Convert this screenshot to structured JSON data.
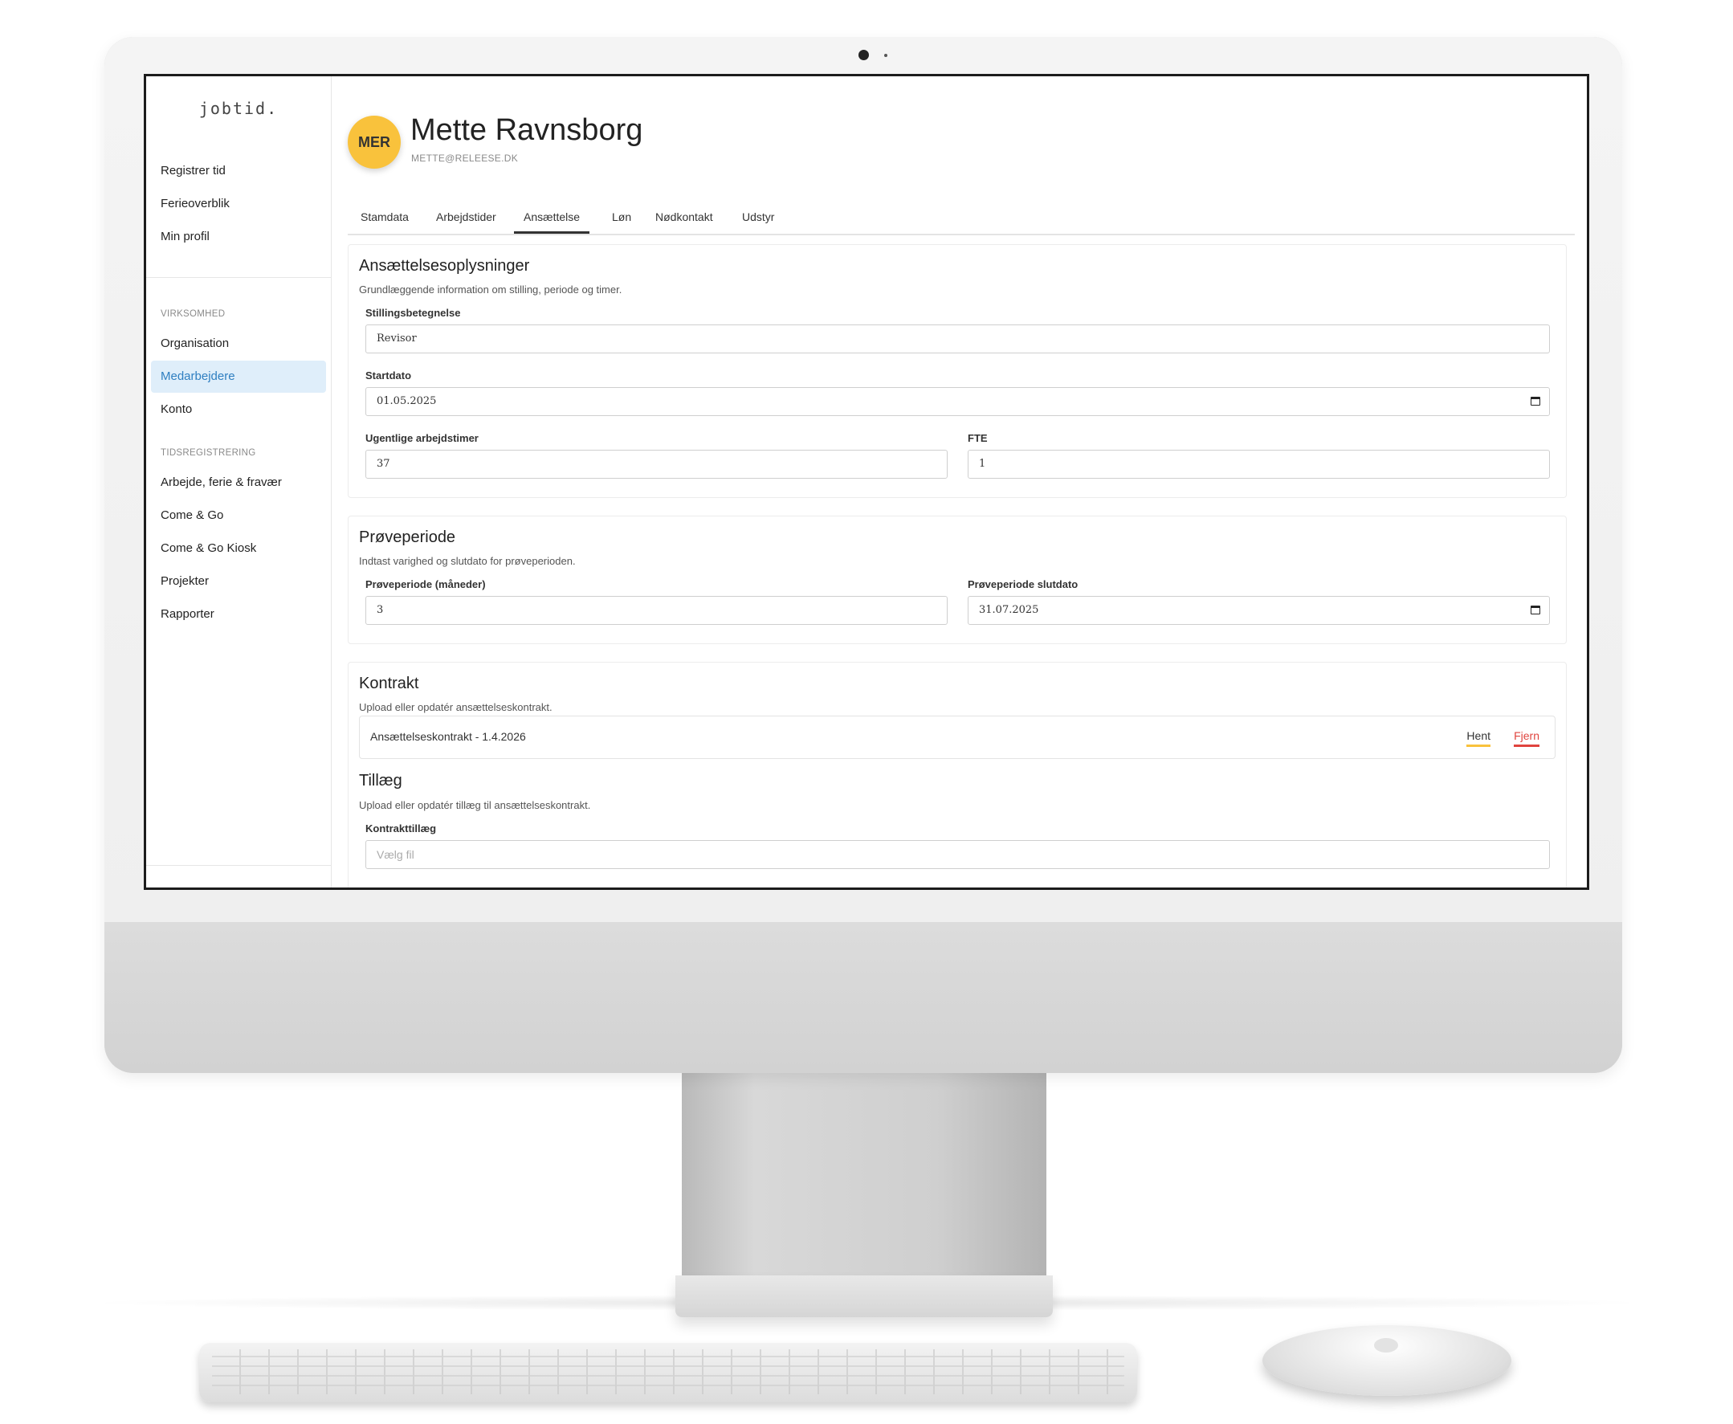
{
  "sidebar": {
    "logo": "jobtid.",
    "top_items": [
      {
        "label": "Registrer tid"
      },
      {
        "label": "Ferieoverblik"
      },
      {
        "label": "Min profil"
      }
    ],
    "sections": [
      {
        "title": "VIRKSOMHED",
        "items": [
          {
            "label": "Organisation",
            "active": false
          },
          {
            "label": "Medarbejdere",
            "active": true
          },
          {
            "label": "Konto",
            "active": false
          }
        ]
      },
      {
        "title": "TIDSREGISTRERING",
        "items": [
          {
            "label": "Arbejde, ferie & fravær"
          },
          {
            "label": "Come & Go"
          },
          {
            "label": "Come & Go Kiosk"
          },
          {
            "label": "Projekter"
          },
          {
            "label": "Rapporter"
          }
        ]
      }
    ]
  },
  "profile": {
    "initials": "MER",
    "name": "Mette Ravnsborg",
    "email": "METTE@RELEESE.DK"
  },
  "tabs": [
    {
      "label": "Stamdata",
      "active": false
    },
    {
      "label": "Arbejdstider",
      "active": false
    },
    {
      "label": "Ansættelse",
      "active": true
    },
    {
      "label": "Løn",
      "active": false
    },
    {
      "label": "Nødkontakt",
      "active": false
    },
    {
      "label": "Udstyr",
      "active": false
    }
  ],
  "employment": {
    "title": "Ansættelsesoplysninger",
    "subtitle": "Grundlæggende information om stilling, periode og timer.",
    "job_title_label": "Stillingsbetegnelse",
    "job_title_value": "Revisor",
    "start_label": "Startdato",
    "start_value": "01.05.2025",
    "hours_label": "Ugentlige arbejdstimer",
    "hours_value": "37",
    "fte_label": "FTE",
    "fte_value": "1"
  },
  "probation": {
    "title": "Prøveperiode",
    "subtitle": "Indtast varighed og slutdato for prøveperioden.",
    "months_label": "Prøveperiode (måneder)",
    "months_value": "3",
    "end_label": "Prøveperiode slutdato",
    "end_value": "31.07.2025"
  },
  "contract": {
    "title": "Kontrakt",
    "subtitle": "Upload eller opdatér ansættelseskontrakt.",
    "file_name": "Ansættelseskontrakt - 1.4.2026",
    "get_label": "Hent",
    "remove_label": "Fjern"
  },
  "addendum": {
    "title": "Tillæg",
    "subtitle": "Upload eller opdatér tillæg til ansættelseskontrakt.",
    "field_label": "Kontrakttillæg",
    "placeholder": "Vælg fil"
  },
  "colors": {
    "accent_active": "#2f7fc1",
    "active_bg": "#dfeefa",
    "avatar": "#f9c23c",
    "danger": "#e0443e"
  },
  "icons": [
    "calendar-icon"
  ]
}
